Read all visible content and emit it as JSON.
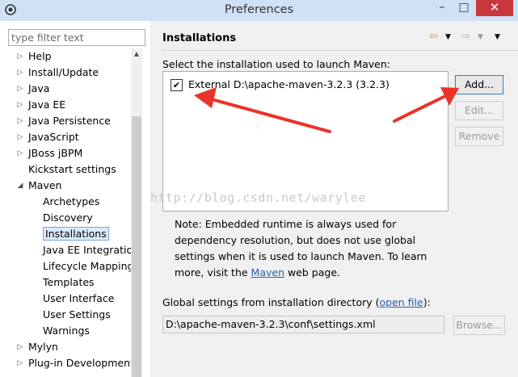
{
  "window": {
    "title": "Preferences",
    "minimize": "–",
    "maximize": "□",
    "close": "✕"
  },
  "filter": {
    "placeholder": "type filter text"
  },
  "tree": [
    {
      "label": "Help",
      "arrow": "▷"
    },
    {
      "label": "Install/Update",
      "arrow": "▷"
    },
    {
      "label": "Java",
      "arrow": "▷"
    },
    {
      "label": "Java EE",
      "arrow": "▷"
    },
    {
      "label": "Java Persistence",
      "arrow": "▷"
    },
    {
      "label": "JavaScript",
      "arrow": "▷"
    },
    {
      "label": "JBoss jBPM",
      "arrow": "▷"
    },
    {
      "label": "Kickstart settings",
      "arrow": ""
    },
    {
      "label": "Maven",
      "arrow": "◢"
    },
    {
      "label": "Archetypes",
      "arrow": ""
    },
    {
      "label": "Discovery",
      "arrow": ""
    },
    {
      "label": "Installations",
      "arrow": ""
    },
    {
      "label": "Java EE Integration",
      "arrow": ""
    },
    {
      "label": "Lifecycle Mapping",
      "arrow": ""
    },
    {
      "label": "Templates",
      "arrow": ""
    },
    {
      "label": "User Interface",
      "arrow": ""
    },
    {
      "label": "User Settings",
      "arrow": ""
    },
    {
      "label": "Warnings",
      "arrow": ""
    },
    {
      "label": "Mylyn",
      "arrow": "▷"
    },
    {
      "label": "Plug-in Development",
      "arrow": "▷"
    }
  ],
  "page": {
    "title": "Installations",
    "instruction": "Select the installation used to launch Maven:",
    "installation": {
      "label": "External D:\\apache-maven-3.2.3 (3.2.3)",
      "checked": true
    },
    "buttons": {
      "add": "Add...",
      "edit": "Edit...",
      "remove": "Remove"
    },
    "note_text": "Note: Embedded runtime is always used for dependency resolution, but does not use global settings when it is used to launch Maven. To learn more, visit the ",
    "note_link": "Maven",
    "note_tail": " web page.",
    "global_prefix": "Global settings from installation directory (",
    "global_link": "open file",
    "global_suffix": "):",
    "settings_path": "D:\\apache-maven-3.2.3\\conf\\settings.xml",
    "browse": "Browse..."
  },
  "watermark": "http://blog.csdn.net/warylee",
  "colors": {
    "titlebar": "#cfe1f5",
    "close": "#c7373b",
    "selection": "#dcebfc",
    "link": "#2b5fa8",
    "annotation": "#e8342a"
  }
}
